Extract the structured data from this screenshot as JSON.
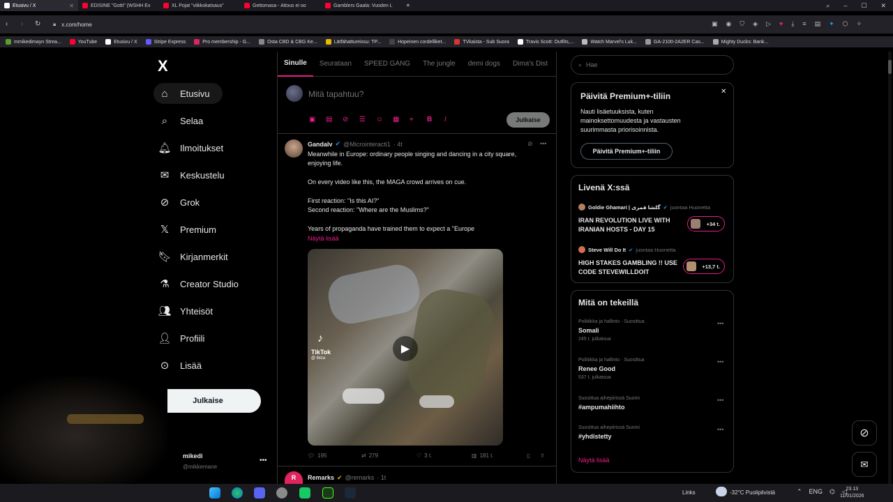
{
  "browser": {
    "tabs": [
      {
        "label": "Etusivu / X",
        "color": "#ffffff"
      },
      {
        "label": "EDISINE \"Gotti\" (WSHH Ex",
        "color": "#ff0033"
      },
      {
        "label": "XL Pojat \"viikkokatsaus\"",
        "color": "#ff0033"
      },
      {
        "label": "Gettomasa - Aitous ei oo",
        "color": "#ff0033"
      },
      {
        "label": "Gamblers Gaala: Vuoden L",
        "color": "#ff0033"
      }
    ],
    "url": "x.com/home",
    "bookmarks": [
      {
        "label": "mmikedimayn Strea...",
        "color": "#5b9d2f"
      },
      {
        "label": "YouTube",
        "color": "#ff0033"
      },
      {
        "label": "Etusivu / X",
        "color": "#ffffff"
      },
      {
        "label": "Stripe Express",
        "color": "#635bff"
      },
      {
        "label": "Pro membership - G...",
        "color": "#e0245e"
      },
      {
        "label": "Osta CBD & CBG Ke...",
        "color": "#888888"
      },
      {
        "label": "Lätfähattureissu: TP...",
        "color": "#e6b800"
      },
      {
        "label": "Hopeinen cordelliket...",
        "color": "#444444"
      },
      {
        "label": "TVkaista - Sub Suora",
        "color": "#d33"
      },
      {
        "label": "Travis Scott: Outfits,...",
        "color": "#ffffff"
      },
      {
        "label": "Watch Marvel's Luk...",
        "color": "#bbbbbb"
      },
      {
        "label": "GA-2100-2A2ER Cas...",
        "color": "#999999"
      },
      {
        "label": "Mighty Ducks: Bank...",
        "color": "#aaaaaa"
      }
    ]
  },
  "nav": {
    "logo": "X",
    "items": [
      {
        "label": "Etusivu",
        "icon": "home-icon"
      },
      {
        "label": "Selaa",
        "icon": "search-icon"
      },
      {
        "label": "Ilmoitukset",
        "icon": "bell-icon"
      },
      {
        "label": "Keskustelu",
        "icon": "mail-icon"
      },
      {
        "label": "Grok",
        "icon": "grok-icon"
      },
      {
        "label": "Premium",
        "icon": "x-icon"
      },
      {
        "label": "Kirjanmerkit",
        "icon": "bookmark-icon"
      },
      {
        "label": "Creator Studio",
        "icon": "flask-icon"
      },
      {
        "label": "Yhteisöt",
        "icon": "people-icon"
      },
      {
        "label": "Profiili",
        "icon": "person-icon"
      },
      {
        "label": "Lisää",
        "icon": "more-icon"
      }
    ],
    "post_button": "Julkaise",
    "account_name": "mikedi",
    "account_handle": "@mikkemane"
  },
  "feed": {
    "tabs": [
      "Sinulle",
      "Seurataan",
      "SPEED GANG",
      "The jungle",
      "demi dogs",
      "Dima's Dist"
    ],
    "compose_placeholder": "Mitä tapahtuu?",
    "compose_submit": "Julkaise",
    "tweet": {
      "author": "Gandalv",
      "handle": "@Microinteracti1",
      "time": "· 4t",
      "lines": [
        "Meanwhile in Europe: ordinary people singing and dancing in a city square,",
        "enjoying life.",
        "",
        "On every video like this, the MAGA crowd arrives on cue.",
        "",
        "First reaction: \"Is this AI?\"",
        "Second reaction: \"Where are the Muslims?\"",
        "",
        "Years of propaganda have trained them to expect a \"Europe"
      ],
      "show_more": "Näytä lisää",
      "video_watermark": "TikTok",
      "video_user": "@ ibiza",
      "replies": "195",
      "reposts": "279",
      "likes": "3 t.",
      "views": "181 t."
    },
    "next_tweet": {
      "author": "Remarks",
      "handle": "@remarks",
      "time": "· 1t"
    }
  },
  "sidebar": {
    "search_placeholder": "Hae",
    "premium": {
      "title": "Päivitä Premium+-tiliin",
      "body": "Nauti lisäetuuksista, kuten mainoksettomuudesta ja vastausten suurimmasta priorisoinnista.",
      "button": "Päivitä Premium+-tiliin"
    },
    "live": {
      "title": "Livenä X:ssä",
      "items": [
        {
          "host": "Goldie Ghamari | گلشا قمری",
          "role": "juontaa Huonetta",
          "title": "IRAN REVOLUTION LIVE WITH IRANIAN HOSTS - DAY 15",
          "count": "+34 t."
        },
        {
          "host": "Steve Will Do It",
          "role": "juontaa Huonetta",
          "title": "HIGH STAKES GAMBLING !! USE CODE STEVEWILLDOIT",
          "count": "+13,7 t."
        }
      ]
    },
    "trends": {
      "title": "Mitä on tekeillä",
      "items": [
        {
          "category": "Politiikka ja hallinto · Suosittua",
          "name": "Somali",
          "count": "245 t. julkaisua"
        },
        {
          "category": "Politiikka ja hallinto · Suosittua",
          "name": "Renee Good",
          "count": "537 t. julkaisua"
        },
        {
          "category": "Suosittua aihepiirissä Suomi",
          "name": "#ampumahiihto",
          "count": ""
        },
        {
          "category": "Suosittua aihepiirissä Suomi",
          "name": "#yhdistetty",
          "count": ""
        }
      ],
      "show_more": "Näytä lisää"
    }
  },
  "taskbar": {
    "links": "Links",
    "weather": "-32°C Puolipilvistä",
    "lang": "ENG",
    "time": "23.13",
    "date": "11/01/2026"
  },
  "colors": {
    "accent": "#e91e8c",
    "verified": "#1d9bf0",
    "border": "#2f3336",
    "muted": "#71767b"
  }
}
